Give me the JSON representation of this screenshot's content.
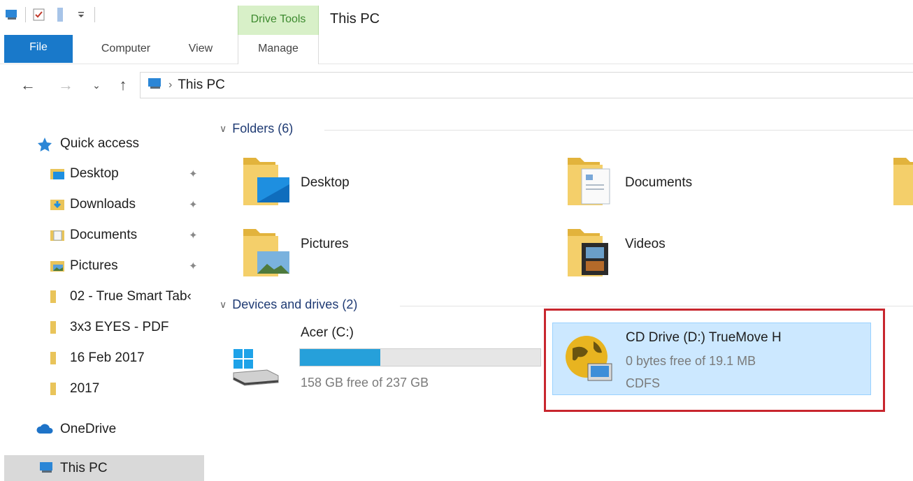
{
  "window": {
    "context_tab": "Drive Tools",
    "title": "This PC"
  },
  "ribbon": {
    "tabs": [
      "File",
      "Computer",
      "View",
      "Manage"
    ]
  },
  "address": {
    "crumb": "This PC"
  },
  "sidebar": {
    "quick_access": "Quick access",
    "items": [
      {
        "label": "Desktop",
        "pinned": true
      },
      {
        "label": "Downloads",
        "pinned": true
      },
      {
        "label": "Documents",
        "pinned": true
      },
      {
        "label": "Pictures",
        "pinned": true
      },
      {
        "label": "02 - True Smart Tab‹",
        "pinned": false
      },
      {
        "label": "3x3 EYES - PDF",
        "pinned": false
      },
      {
        "label": "16 Feb 2017",
        "pinned": false
      },
      {
        "label": "2017",
        "pinned": false
      }
    ],
    "onedrive": "OneDrive",
    "this_pc": "This PC"
  },
  "content": {
    "folders_header": "Folders (6)",
    "folders": [
      "Desktop",
      "Documents",
      "Pictures",
      "Videos"
    ],
    "devices_header": "Devices and drives (2)",
    "drives": [
      {
        "name": "Acer (C:)",
        "free_text": "158 GB free of 237 GB",
        "used_fraction": 0.333
      },
      {
        "name": "CD Drive (D:) TrueMove H",
        "free_text": "0 bytes free of 19.1 MB",
        "filesystem": "CDFS"
      }
    ]
  },
  "colors": {
    "accent": "#1979ca",
    "selection": "#cce8ff",
    "highlight_box": "#c8262e",
    "drive_bar": "#26a0da"
  }
}
